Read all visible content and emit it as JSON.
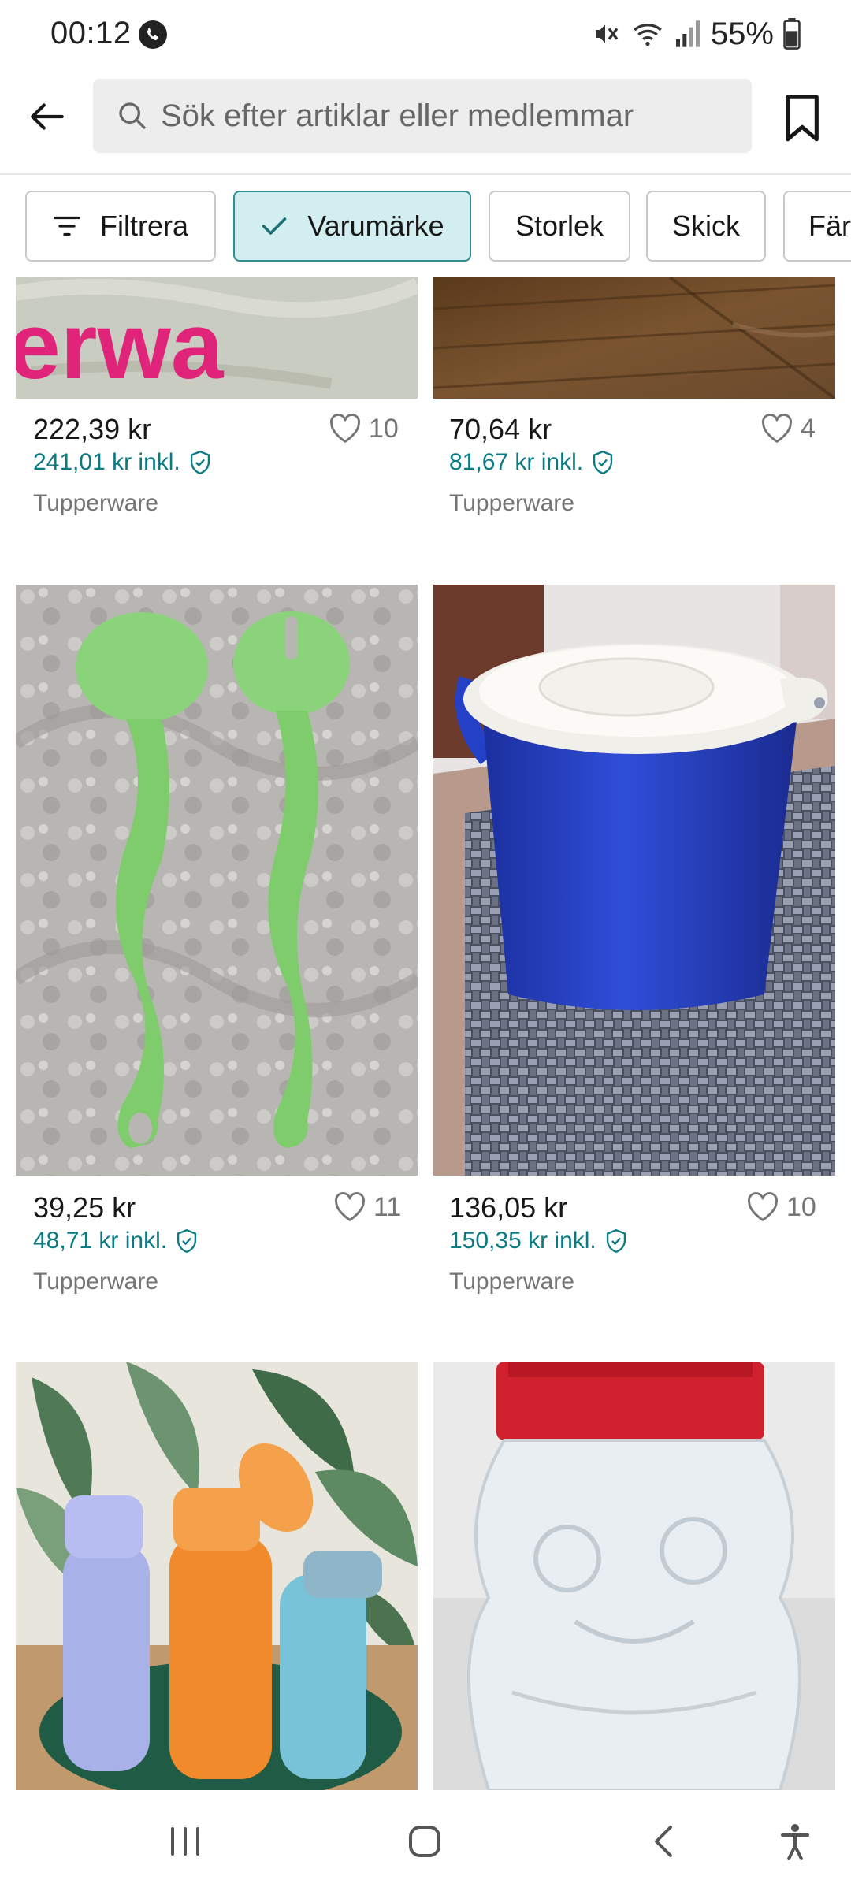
{
  "status_bar": {
    "time": "00:12",
    "battery": "55%",
    "icons": [
      "call-icon",
      "mute-icon",
      "wifi-icon",
      "signal-icon",
      "battery-icon"
    ]
  },
  "search": {
    "placeholder": "Sök efter artiklar eller medlemmar"
  },
  "filters": [
    {
      "label": "Filtrera",
      "selected": false,
      "icon": "filter-icon"
    },
    {
      "label": "Varumärke",
      "selected": true,
      "icon": "check-icon"
    },
    {
      "label": "Storlek",
      "selected": false
    },
    {
      "label": "Skick",
      "selected": false
    },
    {
      "label": "Färg",
      "selected": false
    }
  ],
  "products": [
    {
      "price": "222,39 kr",
      "price_incl": "241,01 kr inkl.",
      "brand": "Tupperware",
      "favorites": "10",
      "image": "pink-tupperware-logo-print",
      "image_text": "erwa"
    },
    {
      "price": "70,64 kr",
      "price_incl": "81,67 kr inkl.",
      "brand": "Tupperware",
      "favorites": "4",
      "image": "wooden-floor"
    },
    {
      "price": "39,25 kr",
      "price_incl": "48,71 kr inkl.",
      "brand": "Tupperware",
      "favorites": "11",
      "image": "green-salad-servers"
    },
    {
      "price": "136,05 kr",
      "price_incl": "150,35 kr inkl.",
      "brand": "Tupperware",
      "favorites": "10",
      "image": "blue-container-with-white-lid"
    },
    {
      "image": "three-water-bottles"
    },
    {
      "image": "clear-bottle-red-cap"
    }
  ],
  "colors": {
    "accent": "#0a7b83",
    "chip_selected_bg": "#d3eef0",
    "chip_selected_border": "#2f8f92"
  },
  "nav": [
    "recent-apps-icon",
    "home-icon",
    "back-icon",
    "accessibility-icon"
  ]
}
